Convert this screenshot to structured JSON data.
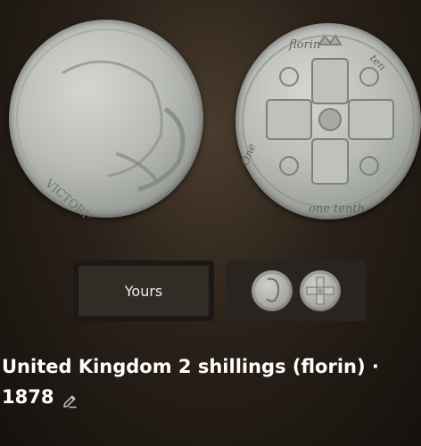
{
  "coin": {
    "obverse_legend": "VICTORIA",
    "reverse_legend_top": "florin",
    "reverse_legend_right": "ten",
    "reverse_legend_left": "One",
    "reverse_legend_bottom": "one tenth"
  },
  "variant_selector": {
    "yours_label": "Yours"
  },
  "title": {
    "line1": "United Kingdom 2 shillings (florin) ·",
    "line2": "1878"
  },
  "icons": {
    "edit": "pencil-icon"
  },
  "colors": {
    "background": "#2a2119",
    "text": "#ffffff",
    "card": "#322c27"
  }
}
